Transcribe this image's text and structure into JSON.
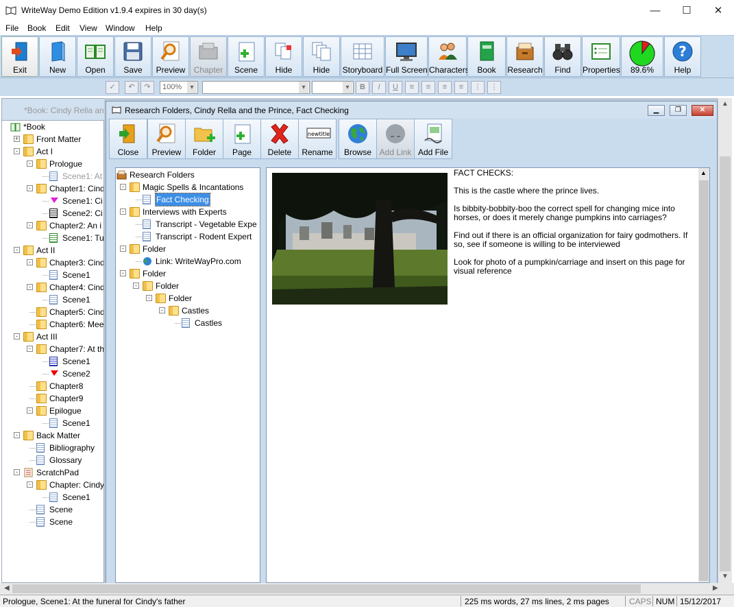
{
  "window": {
    "title": "WriteWay Demo Edition v1.9.4  expires in 30 day(s)",
    "minimize": "—",
    "maximize": "☐",
    "close": "✕"
  },
  "menu": [
    "File",
    "Book",
    "Edit",
    "View",
    "Window",
    "Help"
  ],
  "toolbar": [
    {
      "label": "Exit",
      "icon": "exit-door-icon"
    },
    {
      "label": "New",
      "icon": "new-book-icon"
    },
    {
      "label": "Open",
      "icon": "open-book-icon"
    },
    {
      "label": "Save",
      "icon": "floppy-disk-icon"
    },
    {
      "label": "Preview",
      "icon": "magnifier-icon"
    },
    {
      "label": "Chapter",
      "icon": "chapter-folder-icon"
    },
    {
      "label": "Scene",
      "icon": "scene-page-icon"
    },
    {
      "label": "Hide",
      "icon": "hide-pages-icon"
    },
    {
      "label": "Hide",
      "icon": "hide-docs-icon"
    },
    {
      "label": "Storyboard",
      "icon": "storyboard-grid-icon"
    },
    {
      "label": "Full Screen",
      "icon": "monitor-icon"
    },
    {
      "label": "Characters",
      "icon": "people-icon"
    },
    {
      "label": "Book",
      "icon": "green-book-icon"
    },
    {
      "label": "Research",
      "icon": "research-box-icon"
    },
    {
      "label": "Find",
      "icon": "binoculars-icon"
    },
    {
      "label": "Properties",
      "icon": "properties-icon"
    },
    {
      "label": "89.6%",
      "icon": "progress-pie-icon"
    },
    {
      "label": "Help",
      "icon": "help-icon"
    }
  ],
  "progress_fraction": 0.896,
  "format_bar": {
    "zoom": "100%",
    "font": "",
    "size": "",
    "bold": "B",
    "italic": "I",
    "underline": "U"
  },
  "left_pane": {
    "title": "*Book: Cindy Rella and",
    "nodes": [
      {
        "label": "*Book",
        "depth": 0,
        "icon": "book",
        "exp": ""
      },
      {
        "label": "Front Matter",
        "depth": 1,
        "icon": "folder",
        "exp": "+"
      },
      {
        "label": "Act I",
        "depth": 1,
        "icon": "folder",
        "exp": "−"
      },
      {
        "label": "Prologue",
        "depth": 2,
        "icon": "folder",
        "exp": "−"
      },
      {
        "label": "Scene1: At",
        "depth": 3,
        "icon": "doc",
        "exp": "",
        "selected": true
      },
      {
        "label": "Chapter1: Cind",
        "depth": 2,
        "icon": "folder",
        "exp": "−"
      },
      {
        "label": "Scene1: Ci",
        "depth": 3,
        "icon": "flag-magenta",
        "exp": ""
      },
      {
        "label": "Scene2: Ci",
        "depth": 3,
        "icon": "doc-black",
        "exp": ""
      },
      {
        "label": "Chapter2: An i",
        "depth": 2,
        "icon": "folder",
        "exp": "−"
      },
      {
        "label": "Scene1: Tu",
        "depth": 3,
        "icon": "doc-green",
        "exp": ""
      },
      {
        "label": "Act II",
        "depth": 1,
        "icon": "folder",
        "exp": "−"
      },
      {
        "label": "Chapter3: Cind",
        "depth": 2,
        "icon": "folder",
        "exp": "−"
      },
      {
        "label": "Scene1",
        "depth": 3,
        "icon": "doc",
        "exp": ""
      },
      {
        "label": "Chapter4: Cind",
        "depth": 2,
        "icon": "folder",
        "exp": "−"
      },
      {
        "label": "Scene1",
        "depth": 3,
        "icon": "doc",
        "exp": ""
      },
      {
        "label": "Chapter5: Cind",
        "depth": 2,
        "icon": "folder",
        "exp": ""
      },
      {
        "label": "Chapter6: Mee",
        "depth": 2,
        "icon": "folder",
        "exp": ""
      },
      {
        "label": "Act III",
        "depth": 1,
        "icon": "folder",
        "exp": "−"
      },
      {
        "label": "Chapter7: At th",
        "depth": 2,
        "icon": "folder",
        "exp": "−"
      },
      {
        "label": "Scene1",
        "depth": 3,
        "icon": "doc-blue",
        "exp": ""
      },
      {
        "label": "Scene2",
        "depth": 3,
        "icon": "flag-red",
        "exp": ""
      },
      {
        "label": "Chapter8",
        "depth": 2,
        "icon": "folder",
        "exp": ""
      },
      {
        "label": "Chapter9",
        "depth": 2,
        "icon": "folder",
        "exp": ""
      },
      {
        "label": "Epilogue",
        "depth": 2,
        "icon": "folder",
        "exp": "−"
      },
      {
        "label": "Scene1",
        "depth": 3,
        "icon": "doc",
        "exp": ""
      },
      {
        "label": "Back Matter",
        "depth": 1,
        "icon": "folder",
        "exp": "−"
      },
      {
        "label": "Bibliography",
        "depth": 2,
        "icon": "doc",
        "exp": ""
      },
      {
        "label": "Glossary",
        "depth": 2,
        "icon": "doc",
        "exp": ""
      },
      {
        "label": "ScratchPad",
        "depth": 1,
        "icon": "scratchpad",
        "exp": "−"
      },
      {
        "label": "Chapter: Cindy",
        "depth": 2,
        "icon": "folder",
        "exp": "−"
      },
      {
        "label": "Scene1",
        "depth": 3,
        "icon": "doc",
        "exp": ""
      },
      {
        "label": "Scene",
        "depth": 2,
        "icon": "doc",
        "exp": ""
      },
      {
        "label": "Scene",
        "depth": 2,
        "icon": "doc",
        "exp": ""
      }
    ]
  },
  "research": {
    "title": "Research Folders, Cindy Rella and the Prince, Fact Checking",
    "toolbar": [
      {
        "label": "Close",
        "icon": "exit-door-icon"
      },
      {
        "label": "Preview",
        "icon": "magnifier-icon"
      },
      {
        "label": "Folder",
        "icon": "add-folder-icon"
      },
      {
        "label": "Page",
        "icon": "add-page-icon"
      },
      {
        "label": "Delete",
        "icon": "delete-x-icon"
      },
      {
        "label": "Rename",
        "icon": "rename-newtitle-icon",
        "badge": "newtitle"
      },
      {
        "label": "Browse",
        "icon": "globe-icon"
      },
      {
        "label": "Add Link",
        "icon": "add-link-icon",
        "disabled": true
      },
      {
        "label": "Add File",
        "icon": "add-file-icon"
      }
    ],
    "tree": [
      {
        "label": "Research Folders",
        "depth": 0,
        "icon": "research",
        "exp": ""
      },
      {
        "label": "Magic Spells & Incantations",
        "depth": 1,
        "icon": "folder",
        "exp": "−"
      },
      {
        "label": "Fact Checking",
        "depth": 2,
        "icon": "doc",
        "exp": "",
        "selected": true
      },
      {
        "label": "Interviews with Experts",
        "depth": 1,
        "icon": "folder",
        "exp": "−"
      },
      {
        "label": "Transcript - Vegetable Expe",
        "depth": 2,
        "icon": "doc",
        "exp": ""
      },
      {
        "label": "Transcript - Rodent Expert",
        "depth": 2,
        "icon": "doc",
        "exp": ""
      },
      {
        "label": "Folder",
        "depth": 1,
        "icon": "folder",
        "exp": "−"
      },
      {
        "label": "Link: WriteWayPro.com",
        "depth": 2,
        "icon": "globe",
        "exp": ""
      },
      {
        "label": "Folder",
        "depth": 1,
        "icon": "folder",
        "exp": "−"
      },
      {
        "label": "Folder",
        "depth": 2,
        "icon": "folder",
        "exp": "−"
      },
      {
        "label": "Folder",
        "depth": 3,
        "icon": "folder",
        "exp": "−"
      },
      {
        "label": "Castles",
        "depth": 4,
        "icon": "folder",
        "exp": "−"
      },
      {
        "label": "Castles",
        "depth": 5,
        "icon": "doc",
        "exp": ""
      }
    ],
    "notes": [
      "FACT CHECKS:",
      "This is the castle where the prince lives.",
      "Is bibbity-bobbity-boo the correct spell for changing mice into horses, or does it merely change pumpkins into carriages?",
      "Find out if there is an official organization for fairy godmothers. If so, see if someone is willing to be interviewed",
      "Look for photo of a pumpkin/carriage and insert on this page for visual reference"
    ]
  },
  "status": {
    "left": "Prologue, Scene1: At the funeral for Cindy's father",
    "counts": "225 ms words, 27 ms lines, 2 ms pages",
    "caps": "CAPS",
    "num": "NUM",
    "date": "15/12/2017"
  }
}
